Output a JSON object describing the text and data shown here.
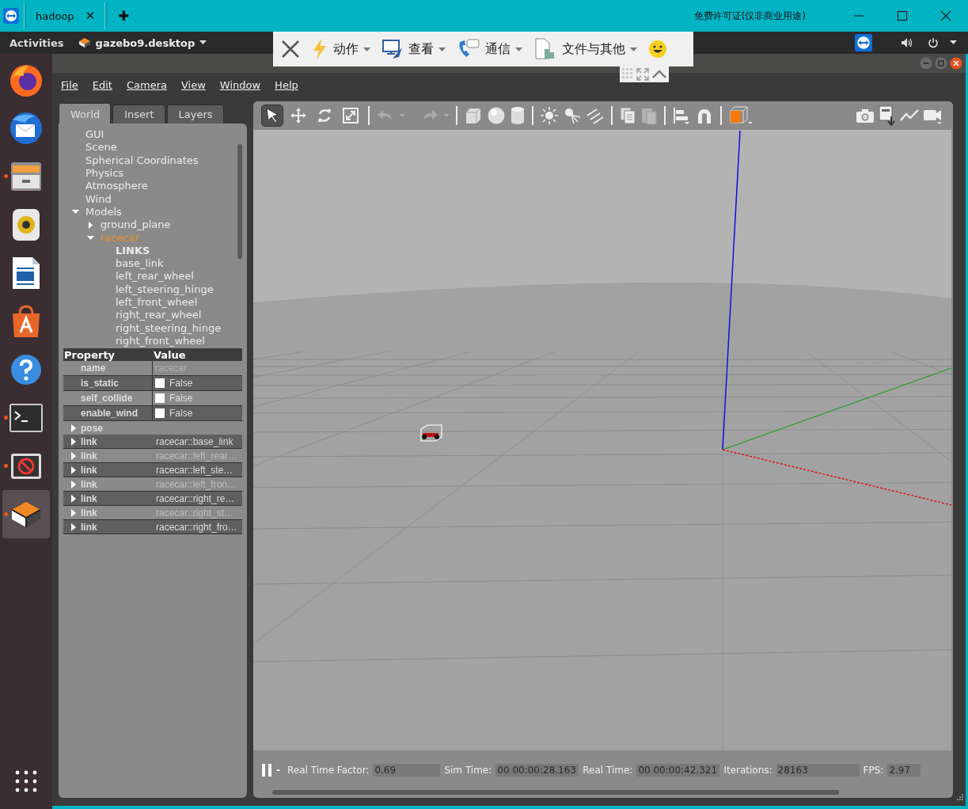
{
  "remote_bar": {
    "tab": "hadoop",
    "tab_close": "✕",
    "new_tab": "✚",
    "license": "免费许可证(仅非商业用途)"
  },
  "remote_toolbar": {
    "menus": [
      {
        "label": "动作",
        "kind": "action"
      },
      {
        "label": "查看",
        "kind": "view"
      },
      {
        "label": "通信",
        "kind": "comm"
      },
      {
        "label": "文件与其他",
        "kind": "file"
      }
    ]
  },
  "top_bar": {
    "activities": "Activities",
    "app": "gazebo9.desktop"
  },
  "dock": [
    {
      "kind": "firefox",
      "running": false
    },
    {
      "kind": "mail",
      "running": false
    },
    {
      "kind": "files",
      "running": true
    },
    {
      "kind": "speaker",
      "running": false
    },
    {
      "kind": "writer",
      "running": false
    },
    {
      "kind": "store",
      "running": false
    },
    {
      "kind": "help",
      "running": false
    },
    {
      "kind": "terminal",
      "running": true
    },
    {
      "kind": "blocked",
      "running": true
    },
    {
      "kind": "gazebo",
      "running": true
    }
  ],
  "menu": [
    "File",
    "Edit",
    "Camera",
    "View",
    "Window",
    "Help"
  ],
  "tabs": [
    {
      "label": "World",
      "selected": true
    },
    {
      "label": "Insert",
      "selected": false
    },
    {
      "label": "Layers",
      "selected": false
    }
  ],
  "tree": [
    {
      "label": "GUI",
      "selected": false
    },
    {
      "label": "Scene",
      "selected": false
    },
    {
      "label": "Spherical Coordinates",
      "selected": false
    },
    {
      "label": "Physics",
      "selected": false
    },
    {
      "label": "Atmosphere",
      "selected": false
    },
    {
      "label": "Wind",
      "selected": false
    },
    {
      "label": "Models",
      "selected": false,
      "expanded": true,
      "children": [
        {
          "label": "ground_plane",
          "selected": false,
          "expanded": false
        },
        {
          "label": "racecar",
          "selected": true,
          "expanded": true,
          "children": [
            {
              "label": "LINKS",
              "kind": "header",
              "selected": false
            },
            {
              "label": "base_link",
              "selected": false
            },
            {
              "label": "left_rear_wheel",
              "selected": false
            },
            {
              "label": "left_steering_hinge",
              "selected": false
            },
            {
              "label": "left_front_wheel",
              "selected": false
            },
            {
              "label": "right_rear_wheel",
              "selected": false
            },
            {
              "label": "right_steering_hinge",
              "selected": false
            },
            {
              "label": "right_front_wheel",
              "selected": false
            }
          ]
        }
      ]
    }
  ],
  "property_table": {
    "columns": [
      "Property",
      "Value"
    ],
    "rows": [
      {
        "name": "name",
        "value": "racecar",
        "kind": "text"
      },
      {
        "name": "is_static",
        "value": "False",
        "kind": "checkbox",
        "checked": false
      },
      {
        "name": "self_collide",
        "value": "False",
        "kind": "checkbox",
        "checked": false
      },
      {
        "name": "enable_wind",
        "value": "False",
        "kind": "checkbox",
        "checked": false
      }
    ],
    "groups": [
      {
        "label": "pose",
        "expanded": false
      },
      {
        "label": "link",
        "value": "racecar::base_link",
        "expanded": false
      },
      {
        "label": "link",
        "value": "racecar::left_rear…",
        "expanded": false
      },
      {
        "label": "link",
        "value": "racecar::left_ste…",
        "expanded": false
      },
      {
        "label": "link",
        "value": "racecar::left_fron…",
        "expanded": false
      },
      {
        "label": "link",
        "value": "racecar::right_re…",
        "expanded": false
      },
      {
        "label": "link",
        "value": "racecar::right_st…",
        "expanded": false
      },
      {
        "label": "link",
        "value": "racecar::right_fro…",
        "expanded": false
      }
    ]
  },
  "tool_modes": [
    {
      "kind": "select",
      "selected": true
    },
    {
      "kind": "move",
      "selected": false
    },
    {
      "kind": "rotate",
      "selected": false
    },
    {
      "kind": "scale",
      "selected": false
    }
  ],
  "status": {
    "step": "-",
    "fields": [
      {
        "label": "Real Time Factor:",
        "value": "0.69"
      },
      {
        "label": "Sim Time:",
        "value": "00 00:00:28.163"
      },
      {
        "label": "Real Time:",
        "value": "00 00:00:42.321"
      },
      {
        "label": "Iterations:",
        "value": "28163"
      },
      {
        "label": "FPS:",
        "value": "2.97"
      }
    ]
  }
}
